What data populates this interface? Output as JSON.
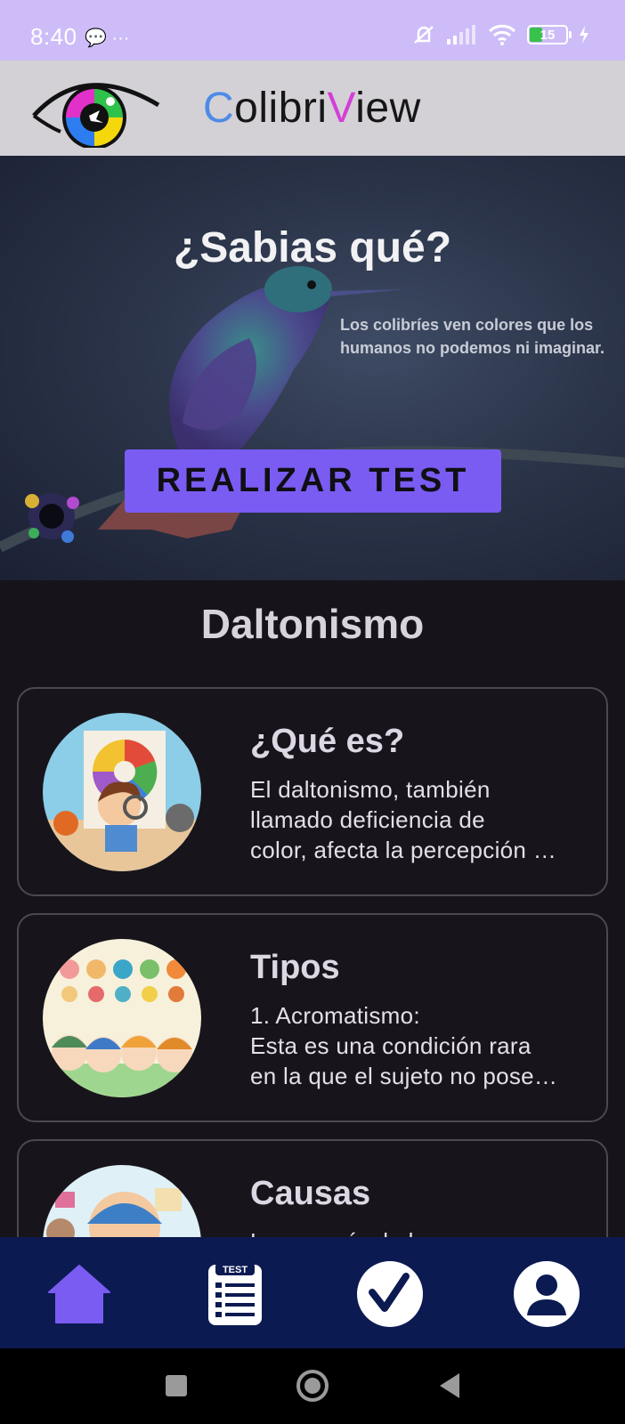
{
  "status_bar": {
    "time": "8:40",
    "left_icons": "💬 ···",
    "battery": "15"
  },
  "header": {
    "brand_parts": [
      "C",
      "olibri",
      "V",
      "iew"
    ],
    "brand_colors": {
      "c": "#4e8be6",
      "v": "#d43ed6"
    }
  },
  "hero": {
    "title": "¿Sabias qué?",
    "text": "Los colibríes ven colores que los humanos no podemos ni imaginar.",
    "button_label": "REALIZAR TEST"
  },
  "section": {
    "title": "Daltonismo"
  },
  "cards": [
    {
      "title": "¿Qué es?",
      "body": "El daltonismo, también\nllamado deficiencia de\ncolor, afecta la percepción …"
    },
    {
      "title": "Tipos",
      "body": " 1. Acromatismo:\n Esta es una condición rara\nen la que el sujeto no pose…"
    },
    {
      "title": "Causas",
      "body": "La mayoría de las personas"
    }
  ],
  "bottom_nav": {
    "items": [
      {
        "icon": "home-icon"
      },
      {
        "icon": "test-icon",
        "label": "TEST"
      },
      {
        "icon": "check-icon"
      },
      {
        "icon": "profile-icon"
      }
    ],
    "active_color": "#7a5cf2"
  }
}
